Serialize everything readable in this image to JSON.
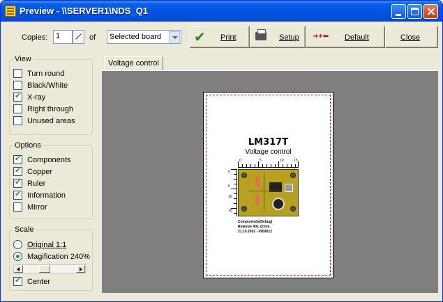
{
  "window": {
    "title": "Preview - \\\\SERVER1\\NDS_Q1"
  },
  "toolbar": {
    "copies_label": "Copies:",
    "copies_value": "1",
    "of_label": "of",
    "board_select_value": "Selected board",
    "print_label": "Print",
    "setup_label": "Setup",
    "default_label": "Default",
    "close_label": "Close"
  },
  "view": {
    "title": "View",
    "items": [
      {
        "label": "Turn round",
        "checked": false
      },
      {
        "label": "Black/White",
        "checked": false
      },
      {
        "label": "X-ray",
        "checked": true
      },
      {
        "label": "Right through",
        "checked": false
      },
      {
        "label": "Unused areas",
        "checked": false
      }
    ]
  },
  "options": {
    "title": "Options",
    "items": [
      {
        "label": "Components",
        "checked": true
      },
      {
        "label": "Copper",
        "checked": true
      },
      {
        "label": "Ruler",
        "checked": true
      },
      {
        "label": "Information",
        "checked": true
      },
      {
        "label": "Mirror",
        "checked": false
      }
    ]
  },
  "scale": {
    "title": "Scale",
    "original_label": "Original 1:1",
    "magnification_label": "Magification 240%",
    "selected": "magnification",
    "center_label": "Center",
    "center_checked": true
  },
  "preview": {
    "tab_label": "Voltage control",
    "board_name": "LM317T",
    "board_subtitle": "Voltage control",
    "ruler_top_numbers": [
      "0",
      "5",
      "10",
      "15"
    ],
    "ruler_left_numbers": [
      "0",
      "5",
      "10",
      "15"
    ],
    "info_lines": [
      "Components(Debug)",
      "Realsize 40x 22mm",
      "21.10.2002 - 0959012"
    ]
  },
  "colors": {
    "title_bar": "#0054e3",
    "preview_background": "#7f7f7f",
    "print_margin": "#e00000",
    "pcb": "#b8a020"
  }
}
